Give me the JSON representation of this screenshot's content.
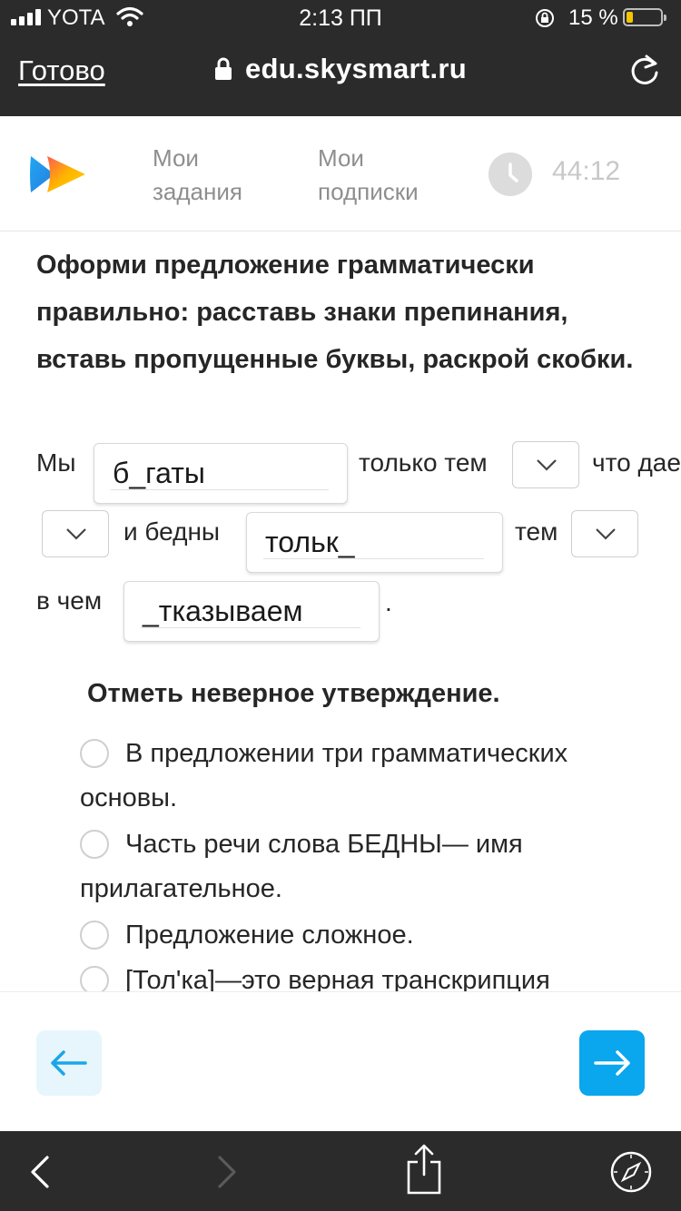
{
  "status_bar": {
    "carrier": "YOTA",
    "time": "2:13 ПП",
    "battery_percent": "15 %",
    "battery_level": 0.15,
    "battery_color": "#f5c400"
  },
  "browser": {
    "done_label": "Готово",
    "url": "edu.skysmart.ru",
    "lock_icon": "lock-icon",
    "reload_icon": "reload-icon"
  },
  "site_header": {
    "nav": [
      {
        "line1": "Мои",
        "line2": "задания"
      },
      {
        "line1": "Мои",
        "line2": "подписки"
      }
    ],
    "timer": "44:12",
    "logo_colors": [
      "#1fa8f2",
      "#ffb400",
      "#ff5a4f"
    ]
  },
  "task1": {
    "instruction": "Оформи предложение грамматически правильно: расставь знаки препинания, вставь пропущенные буквы, раскрой скобки.",
    "word_my": "Мы",
    "input1": "б_гаты",
    "text_only_tem": "только тем",
    "text_chto_da": "что даем",
    "text_i_bedny": "и бедны",
    "input2": "тольк_",
    "text_tem": "тем",
    "text_v_chem": "в чем",
    "input3": "_тказываем",
    "period": "."
  },
  "task2": {
    "title": "Отметь неверное утверждение.",
    "options": [
      "В предложении три грамматических основы.",
      "Часть речи слова БЕДНЫ— имя прилагательное.",
      "Предложение сложное.",
      "[Тол'ка]—это верная транскрипция"
    ]
  },
  "footer": {
    "prev_icon": "arrow-left-icon",
    "next_icon": "arrow-right-icon",
    "accent": "#0aa6ee"
  },
  "bottom_bar": {
    "icons": [
      "back-icon",
      "forward-icon",
      "share-icon",
      "compass-icon"
    ]
  }
}
